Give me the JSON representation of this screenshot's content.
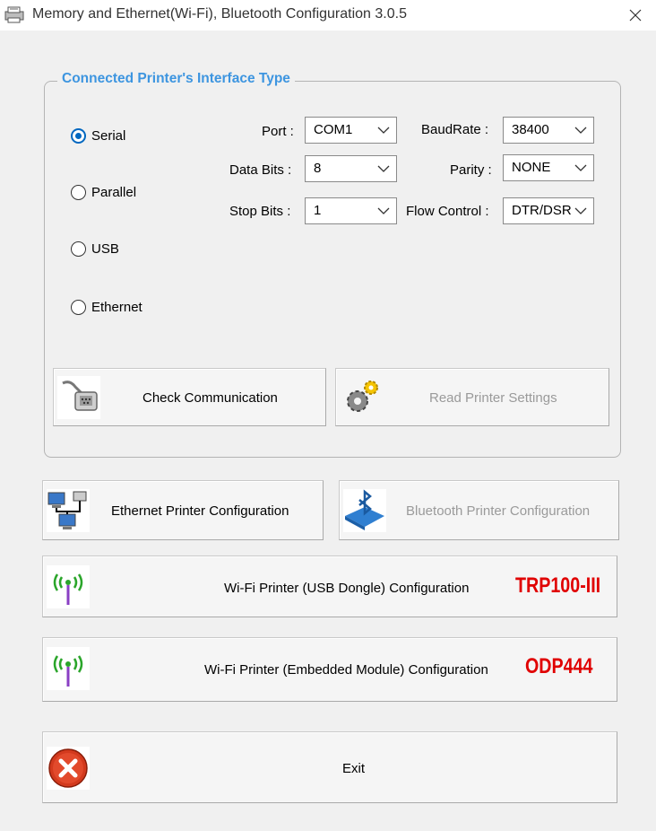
{
  "window": {
    "title": "Memory and Ethernet(Wi-Fi), Bluetooth Configuration 3.0.5"
  },
  "interface_group": {
    "legend": "Connected Printer's Interface Type",
    "radios": [
      {
        "label": "Serial",
        "checked": true
      },
      {
        "label": "Parallel",
        "checked": false
      },
      {
        "label": "USB",
        "checked": false
      },
      {
        "label": "Ethernet",
        "checked": false
      }
    ],
    "fields": {
      "port": {
        "label": "Port :",
        "value": "COM1"
      },
      "data_bits": {
        "label": "Data Bits :",
        "value": "8"
      },
      "stop_bits": {
        "label": "Stop Bits :",
        "value": "1"
      },
      "baud_rate": {
        "label": "BaudRate :",
        "value": "38400"
      },
      "parity": {
        "label": "Parity :",
        "value": "NONE"
      },
      "flow_control": {
        "label": "Flow Control :",
        "value": "DTR/DSR"
      }
    },
    "check_communication": {
      "label": "Check Communication",
      "icon": "serial-cable-icon"
    },
    "read_printer_settings": {
      "label": "Read Printer Settings",
      "icon": "gears-icon",
      "enabled": false
    }
  },
  "buttons": {
    "ethernet_config": {
      "label": "Ethernet Printer Configuration",
      "icon": "network-computers-icon"
    },
    "bluetooth_config": {
      "label": "Bluetooth Printer Configuration",
      "icon": "bluetooth-icon",
      "enabled": false
    },
    "wifi_usb_dongle": {
      "label": "Wi-Fi Printer (USB Dongle) Configuration",
      "badge": "TRP100-III",
      "icon": "wifi-antenna-icon"
    },
    "wifi_embedded": {
      "label": "Wi-Fi Printer (Embedded Module) Configuration",
      "badge": "ODP444",
      "icon": "wifi-antenna-icon"
    },
    "exit": {
      "label": "Exit",
      "icon": "exit-x-icon"
    }
  },
  "colors": {
    "legend": "#3d95e0",
    "badge": "#e00000",
    "accent": "#0067c0",
    "disabled_text": "#9a9a9a"
  }
}
